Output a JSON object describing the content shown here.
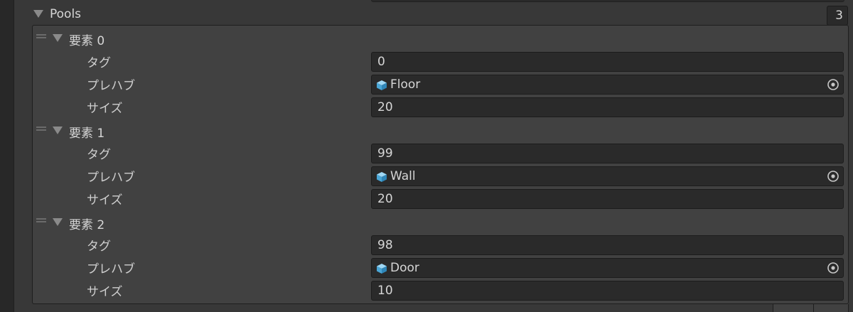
{
  "list": {
    "label": "Pools",
    "count": "3"
  },
  "elements": [
    {
      "header": "要素 0",
      "tag_label": "タグ",
      "tag_value": "0",
      "prefab_label": "プレハブ",
      "prefab_value": "Floor",
      "size_label": "サイズ",
      "size_value": "20"
    },
    {
      "header": "要素 1",
      "tag_label": "タグ",
      "tag_value": "99",
      "prefab_label": "プレハブ",
      "prefab_value": "Wall",
      "size_label": "サイズ",
      "size_value": "20"
    },
    {
      "header": "要素 2",
      "tag_label": "タグ",
      "tag_value": "98",
      "prefab_label": "プレハブ",
      "prefab_value": "Door",
      "size_label": "サイズ",
      "size_value": "10"
    }
  ],
  "icons": {
    "prefab": "prefab-cube-icon",
    "picker": "object-picker-icon",
    "foldout": "foldout-arrow-icon",
    "drag": "drag-handle-icon"
  },
  "colors": {
    "prefab_icon": "#5cb8e8",
    "background": "#383838",
    "field": "#2a2a2a",
    "list_box": "#414141"
  }
}
